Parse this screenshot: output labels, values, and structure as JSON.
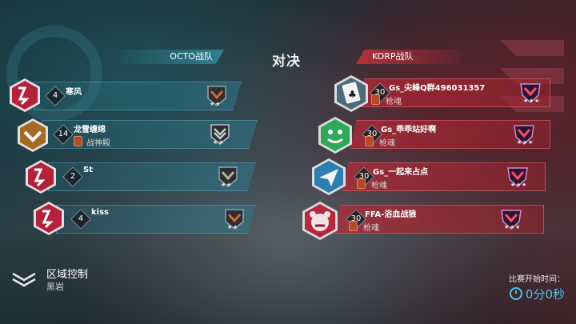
{
  "header": {
    "vs_label": "对决"
  },
  "teams": {
    "left": {
      "name": "OCTO战队",
      "color": "#3aa4bf",
      "players": [
        {
          "level": "4",
          "name": "寒风",
          "clan": "",
          "avatar": "crimson-emblem-icon",
          "rank": "bronze-chevron-icon",
          "stars": 2
        },
        {
          "level": "14",
          "name": "龙雪缠绵",
          "clan": "战神殿",
          "avatar": "gold-emblem-icon",
          "rank": "silver-chevron-icon",
          "stars": 2
        },
        {
          "level": "2",
          "name": "St",
          "clan": "",
          "avatar": "crimson-emblem-icon",
          "rank": "bronze-chevron-icon",
          "stars": 2
        },
        {
          "level": "4",
          "name": "kiss",
          "clan": "",
          "avatar": "crimson-emblem-icon",
          "rank": "bronze-chevron-icon",
          "stars": 2
        }
      ]
    },
    "right": {
      "name": "KORP战队",
      "color": "#c8323f",
      "players": [
        {
          "level": "30",
          "name": "Gs_尖峰Q群496031357",
          "clan": "枪魂",
          "avatar": "club-card-icon",
          "rank": "elite-chevron-icon",
          "stars": 3
        },
        {
          "level": "30",
          "name": "Gs_乖乖站好啊",
          "clan": "枪魂",
          "avatar": "green-face-icon",
          "rank": "elite-chevron-icon",
          "stars": 3
        },
        {
          "level": "30",
          "name": "Gs_一起来占点",
          "clan": "枪魂",
          "avatar": "paper-plane-icon",
          "rank": "elite-chevron-icon",
          "stars": 3
        },
        {
          "level": "30",
          "name": "FFA-浴血战狼",
          "clan": "枪魂",
          "avatar": "bear-icon",
          "rank": "elite-chevron-icon",
          "stars": 3
        }
      ]
    }
  },
  "mode": {
    "title": "区域控制",
    "map": "黑岩"
  },
  "timer": {
    "label": "比赛开始时间：",
    "value": "0分0秒"
  }
}
